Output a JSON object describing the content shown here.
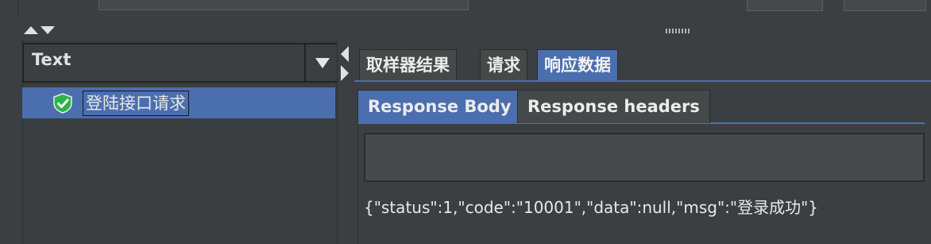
{
  "viewer": {
    "renderer": "Text",
    "tree": [
      {
        "label": "登陆接口请求",
        "status_icon": "check-shield-icon",
        "selected": true
      }
    ]
  },
  "tabs": [
    {
      "label": "取样器结果",
      "active": false
    },
    {
      "label": "请求",
      "active": false
    },
    {
      "label": "响应数据",
      "active": true
    }
  ],
  "subtabs": [
    {
      "label": "Response Body",
      "active": true
    },
    {
      "label": "Response headers",
      "active": false
    }
  ],
  "response_body": "{\"status\":1,\"code\":\"10001\",\"data\":null,\"msg\":\"登录成功\"}",
  "colors": {
    "selection": "#4b6eaf",
    "success": "#2fb24a"
  }
}
